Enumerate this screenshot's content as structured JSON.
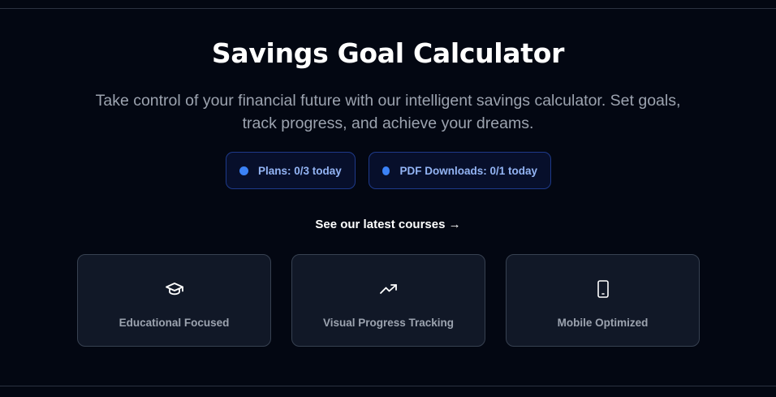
{
  "header": {
    "title": "Savings Goal Calculator",
    "subtitle": "Take control of your financial future with our intelligent savings calculator. Set goals, track progress, and achieve your dreams."
  },
  "badges": [
    {
      "label": "Plans: 0/3 today",
      "dot_color": "#3b82f6"
    },
    {
      "label": "PDF Downloads: 0/1 today",
      "dot_color": "#3b82f6"
    }
  ],
  "courses_link": {
    "label": "See our latest courses →"
  },
  "features": [
    {
      "icon": "graduation-cap-icon",
      "label": "Educational Focused"
    },
    {
      "icon": "trending-up-icon",
      "label": "Visual Progress Tracking"
    },
    {
      "icon": "smartphone-icon",
      "label": "Mobile Optimized"
    }
  ],
  "colors": {
    "background": "#030712",
    "card_background": "#111827",
    "accent": "#3b82f6"
  }
}
